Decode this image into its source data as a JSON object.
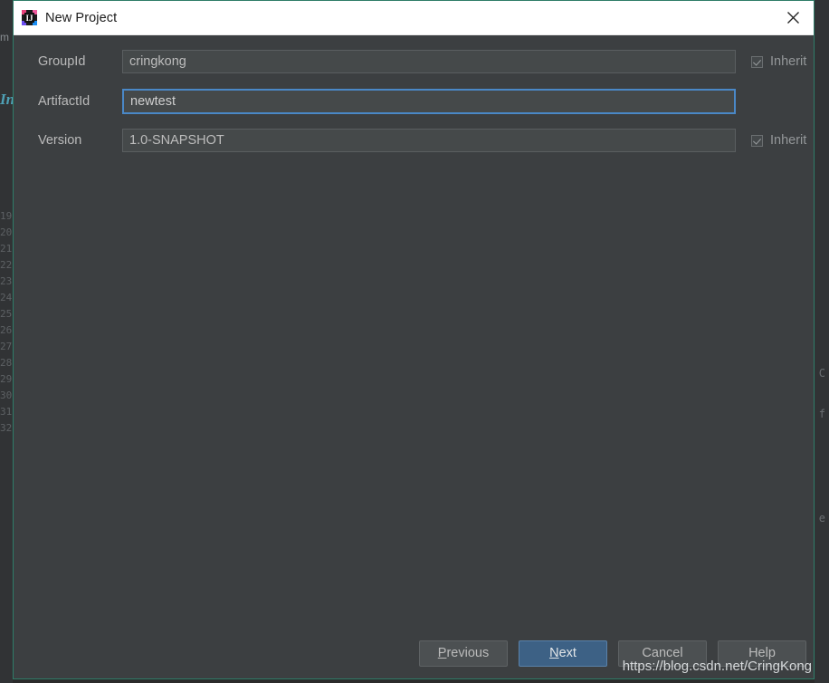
{
  "window": {
    "title": "New Project",
    "app_icon": "intellij-idea-icon",
    "close_icon": "close-icon",
    "titlebar_bg": "#ffffff",
    "body_bg": "#3c3f41",
    "border_color": "#2f7d68"
  },
  "form": {
    "rows": [
      {
        "label": "GroupId",
        "value": "cringkong",
        "focused": false,
        "has_inherit": true,
        "inherit_label": "Inherit",
        "inherit_checked": true
      },
      {
        "label": "ArtifactId",
        "value": "newtest",
        "focused": true,
        "has_inherit": false,
        "inherit_label": "",
        "inherit_checked": false
      },
      {
        "label": "Version",
        "value": "1.0-SNAPSHOT",
        "focused": false,
        "has_inherit": true,
        "inherit_label": "Inherit",
        "inherit_checked": true
      }
    ]
  },
  "footer": {
    "buttons": [
      {
        "label": "Previous",
        "mnemonic": "P",
        "primary": false
      },
      {
        "label": "Next",
        "mnemonic": "N",
        "primary": true
      },
      {
        "label": "Cancel",
        "mnemonic": "",
        "primary": false
      },
      {
        "label": "Help",
        "mnemonic": "",
        "primary": false
      }
    ]
  },
  "watermark": {
    "text": "https://blog.csdn.net/CringKong"
  },
  "background": {
    "gutter_line_numbers": "19\n20\n21\n22\n23\n24\n25\n26\n27\n28\n29\n30\n31\n32",
    "left_fragments": [
      "m",
      "In"
    ],
    "right_fragments": [
      "C",
      "f",
      "e"
    ]
  },
  "colors": {
    "accent_blue": "#3d6185",
    "focus_border": "#4a88c7",
    "dialog_bg": "#3c3f41",
    "field_bg": "#45494a",
    "text": "#bbbbbb",
    "window_border": "#2f7d68"
  }
}
